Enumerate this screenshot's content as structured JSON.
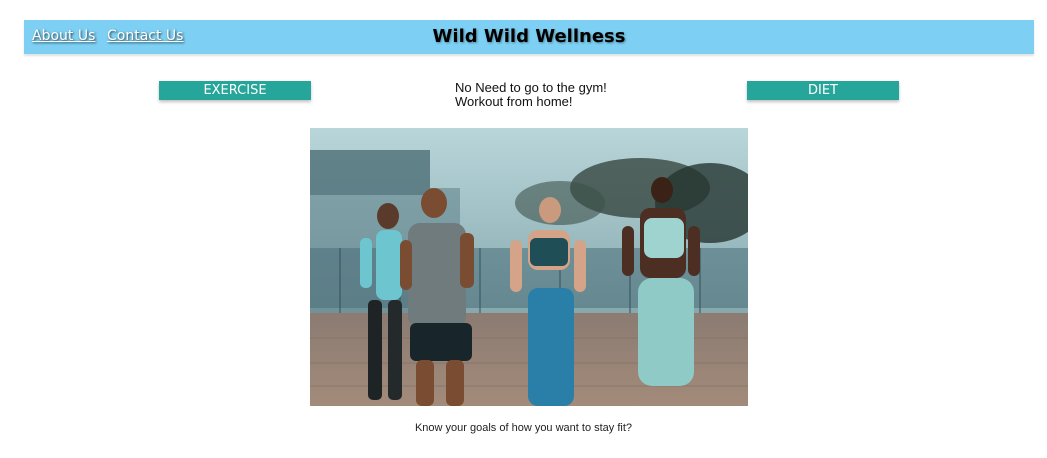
{
  "nav": {
    "about_label": "About Us",
    "contact_label": "Contact Us",
    "title": "Wild Wild Wellness"
  },
  "buttons": {
    "exercise_label": "EXERCISE",
    "diet_label": "DIET"
  },
  "tagline": {
    "line1": "No Need to go to the gym!",
    "line2": "Workout from home!"
  },
  "caption": "Know your goals of how you want to stay fit?",
  "colors": {
    "navbar": "#7dd0f3",
    "button": "#26a69a"
  }
}
